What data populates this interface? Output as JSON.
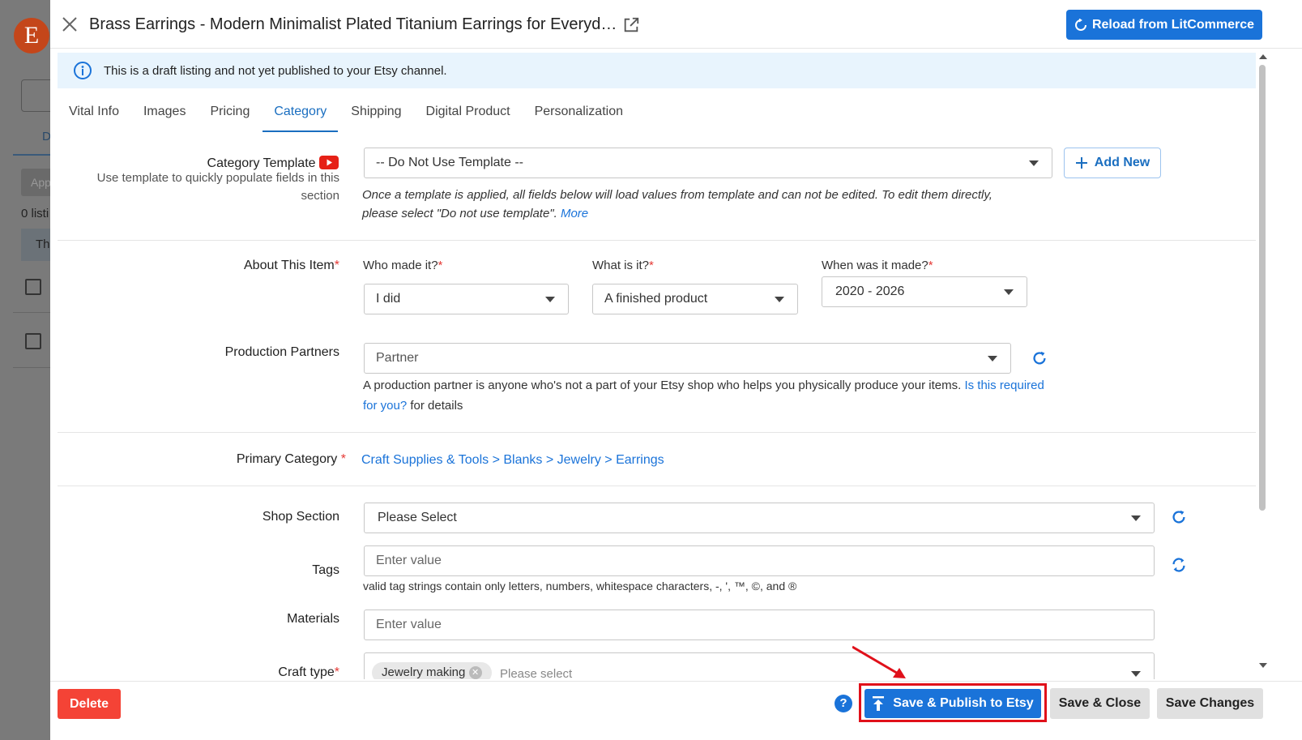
{
  "background": {
    "logo_letter": "E",
    "tab_partial": "D",
    "button_partial": "App",
    "count_partial": "0 listi",
    "row_partial": "Th"
  },
  "header": {
    "title": "Brass Earrings - Modern Minimalist Plated Titanium Earrings for Everyd…",
    "reload_label": "Reload from LitCommerce"
  },
  "info_banner": "This is a draft listing and not yet published to your Etsy channel.",
  "tabs": [
    {
      "label": "Vital Info"
    },
    {
      "label": "Images"
    },
    {
      "label": "Pricing"
    },
    {
      "label": "Category"
    },
    {
      "label": "Shipping"
    },
    {
      "label": "Digital Product"
    },
    {
      "label": "Personalization"
    }
  ],
  "active_tab": "Category",
  "category_template": {
    "label": "Category Template",
    "help_line1": "Use template to quickly populate fields in this",
    "help_line2": "section",
    "value": "-- Do Not Use Template --",
    "add_new": "Add New",
    "note_line1": "Once a template is applied, all fields below will load values from template and can not be edited. To edit them directly,",
    "note_line2": "please select \"Do not use template\".",
    "note_more": "More"
  },
  "about_item": {
    "label": "About This Item",
    "who_label": "Who made it?",
    "who_value": "I did",
    "what_label": "What is it?",
    "what_value": "A finished product",
    "when_label": "When was it made?",
    "when_value": "2020 - 2026"
  },
  "production_partners": {
    "label": "Production Partners",
    "placeholder": "Partner",
    "note_text": "A production partner is anyone who's not a part of your Etsy shop who helps you physically produce your items.",
    "note_link1": "Is this",
    "note_link2": "required for you?",
    "note_tail": "for details"
  },
  "primary_category": {
    "label": "Primary Category",
    "path": "Craft Supplies & Tools > Blanks > Jewelry > Earrings"
  },
  "shop_section": {
    "label": "Shop Section",
    "value": "Please Select"
  },
  "tags": {
    "label": "Tags",
    "placeholder": "Enter value",
    "note": "valid tag strings contain only letters, numbers, whitespace characters, -, ', ™, ©, and ®"
  },
  "materials": {
    "label": "Materials",
    "placeholder": "Enter value"
  },
  "craft_type": {
    "label": "Craft type",
    "chip": "Jewelry making",
    "placeholder": "Please select"
  },
  "footer": {
    "delete": "Delete",
    "help": "?",
    "publish": "Save & Publish to Etsy",
    "save_close": "Save & Close",
    "save_changes": "Save Changes"
  },
  "colors": {
    "primary": "#1a73d9",
    "danger": "#f44336",
    "highlight": "#e0101a",
    "info_bg": "#e8f4fd"
  }
}
